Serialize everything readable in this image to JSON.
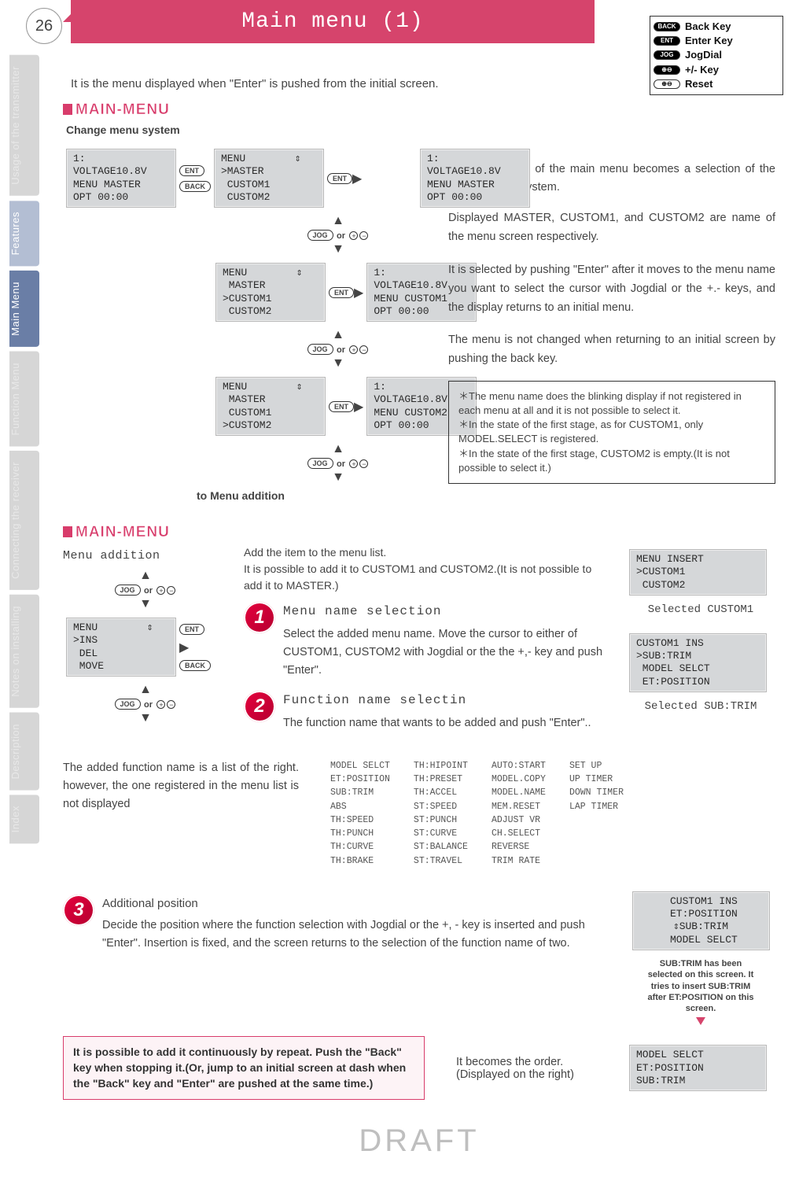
{
  "page_number": "26",
  "header_title": "Main menu (1)",
  "legend": {
    "back": "Back Key",
    "enter": "Enter Key",
    "jog": "JogDial",
    "pm": "+/- Key",
    "reset": "Reset"
  },
  "sidebar": {
    "tabs": [
      "Usage of the transmitter",
      "Features",
      "Main Menu",
      "Function Menu",
      "Connecting the receiver",
      "Notes on installing",
      "Description",
      "Index"
    ]
  },
  "intro": "It is the menu displayed when \"Enter\" is pushed from the initial screen.",
  "section1_title": "MAIN-MENU",
  "change_menu_label": "Change menu system",
  "lcd_initial": "1:\nVOLTAGE10.8V\nMENU MASTER\nOPT 00:00",
  "lcd_menu_master": "MENU        ⇕\n>MASTER\n CUSTOM1\n CUSTOM2",
  "lcd_master_sel": "1:\nVOLTAGE10.8V\nMENU MASTER\nOPT 00:00",
  "lcd_menu_custom1": "MENU        ⇕\n MASTER\n>CUSTOM1\n CUSTOM2",
  "lcd_custom1_sel": "1:\nVOLTAGE10.8V\nMENU CUSTOM1\nOPT 00:00",
  "lcd_menu_custom2": "MENU        ⇕\n MASTER\n CUSTOM1\n>CUSTOM2",
  "lcd_custom2_sel": "1:\nVOLTAGE10.8V\nMENU CUSTOM2\nOPT 00:00",
  "btn_ent": "ENT",
  "btn_back": "BACK",
  "btn_jog": "JOG",
  "or_text": "or",
  "plus": "+",
  "minus": "−",
  "to_addition": "to Menu addition",
  "right_p1": "The first screen of the main menu becomes a selection of the change menu system.",
  "right_p2": "Displayed MASTER, CUSTOM1, and CUSTOM2 are name of the menu screen respectively.",
  "right_p3": "It is selected by pushing \"Enter\" after it moves to the menu name you want to select the cursor with Jogdial or the +.- keys, and the display returns to an initial menu.",
  "right_p4": "The menu is not changed when returning to an initial screen by pushing the back key.",
  "notebox": "＊The menu name does the blinking display if not registered in each menu at all and it is not possible to select it.\n＊In the state of the first stage, as for CUSTOM1, only MODEL.SELECT is registered.\n＊In the state of the first stage, CUSTOM2 is empty.(It is not possible to select it.)",
  "section2_title": "MAIN-MENU",
  "menu_addition_label": "Menu addition",
  "add_intro": "Add the item to the menu list.\nIt is possible to add it to CUSTOM1 and CUSTOM2.(It is not possible to add it to MASTER.)",
  "lcd_ins": "MENU        ⇕\n>INS\n DEL\n MOVE",
  "step1_title": "Menu name selection",
  "step1_text": "Select the added menu name. Move the cursor to either of CUSTOM1, CUSTOM2 with Jogdial or the the +,- key and push \"Enter\".",
  "step2_title": "Function name selectin",
  "step2_text": "The function name that wants to be added and push \"Enter\"..",
  "lcd_menu_insert": "MENU INSERT\n>CUSTOM1\n CUSTOM2",
  "selected_c1": "Selected CUSTOM1",
  "lcd_custom1_ins": "CUSTOM1 INS\n>SUB:TRIM\n MODEL SELCT\n ET:POSITION",
  "selected_sub": "Selected SUB:TRIM",
  "listed_note": "The added function name is a list of the right. however, the one registered in the menu list is not displayed",
  "func_cols": {
    "c1": "MODEL SELCT\nET:POSITION\nSUB:TRIM\nABS\nTH:SPEED\nTH:PUNCH\nTH:CURVE\nTH:BRAKE",
    "c2": "TH:HIPOINT\nTH:PRESET\nTH:ACCEL\nST:SPEED\nST:PUNCH\nST:CURVE\nST:BALANCE\nST:TRAVEL",
    "c3": "AUTO:START\nMODEL.COPY\nMODEL.NAME\nMEM.RESET\nADJUST VR\nCH.SELECT\nREVERSE\nTRIM RATE",
    "c4": "SET UP\nUP TIMER\nDOWN TIMER\nLAP TIMER"
  },
  "step3_title": "Additional position",
  "step3_text": "Decide the position where the function selection with Jogdial or the +, - key is inserted and push \"Enter\". Insertion is fixed, and the screen returns to the selection of the function name of two.",
  "lcd_pos": " CUSTOM1 INS\n ET:POSITION\n⇕SUB:TRIM\n MODEL SELCT",
  "pos_caption": "SUB:TRIM has been selected on this screen. It tries to insert SUB:TRIM after ET:POSITION on this screen.",
  "lcd_result": "MODEL SELCT\nET:POSITION\nSUB:TRIM",
  "pink_note": "It is possible to add it continuously by repeat. Push the \"Back\" key when stopping it.(Or, jump to an initial screen at dash when the \"Back\" key and \"Enter\" are pushed at the same time.)",
  "order_note": "It becomes the order.\n(Displayed on the right)",
  "draft": "DRAFT"
}
